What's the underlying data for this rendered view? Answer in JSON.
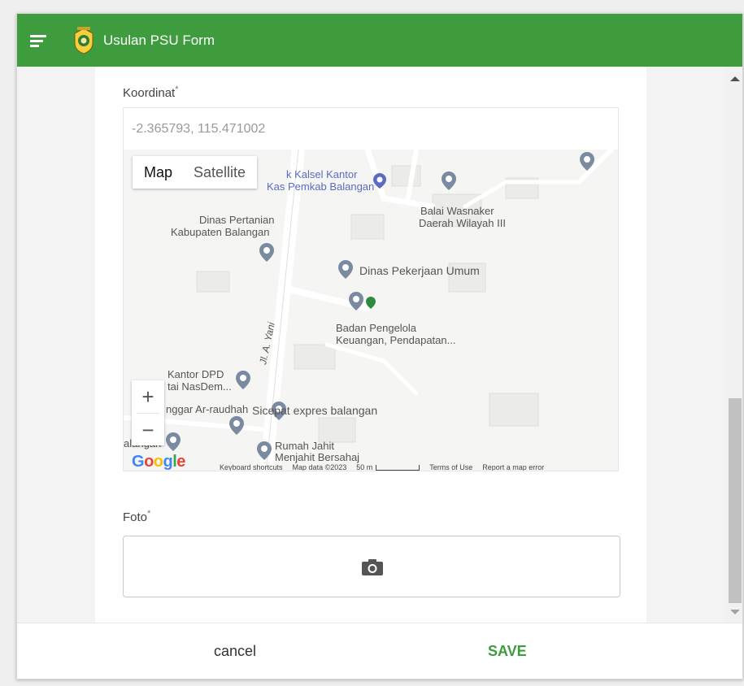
{
  "app": {
    "title": "Usulan PSU Form"
  },
  "koordinat": {
    "label": "Koordinat",
    "required_mark": "*",
    "value": "-2.365793, 115.471002"
  },
  "map": {
    "type_map": "Map",
    "type_satellite": "Satellite",
    "zoom_in": "+",
    "zoom_out": "−",
    "places": {
      "p1": "k Kalsel Kantor",
      "p1b": "Kas Pemkab Balangan",
      "p2": "Balai Wasnaker",
      "p2b": "Daerah Wilayah III",
      "p3": "Dinas Pertanian",
      "p3b": "Kabupaten Balangan",
      "p4": "Dinas Pekerjaan Umum",
      "p5": "Badan Pengelola",
      "p5b": "Keuangan, Pendapatan...",
      "p6": "Kantor DPD",
      "p6b": "tai NasDem...",
      "p7": "nggar Ar-raudhah",
      "p8": "Sicepat expres balangan",
      "p9": "Rumah Jahit",
      "p9b": "Menjahit Bersahaj",
      "p10": "alangan",
      "road": "Jl. A. Yani"
    },
    "google": "Google",
    "footer": {
      "shortcuts": "Keyboard shortcuts",
      "data": "Map data ©2023",
      "scale": "50 m",
      "terms": "Terms of Use",
      "report": "Report a map error"
    }
  },
  "foto": {
    "label": "Foto",
    "required_mark": "*"
  },
  "actions": {
    "cancel": "cancel",
    "save": "SAVE"
  },
  "colors": {
    "appbar": "#3e9c3e",
    "save": "#3e9c3e",
    "pin": "#7a8aa0",
    "marker": "#2e8b3e"
  }
}
